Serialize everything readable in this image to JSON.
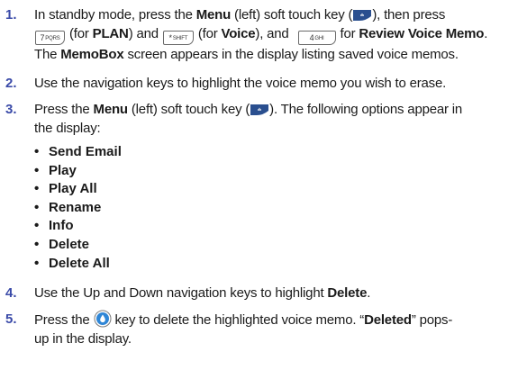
{
  "steps": [
    {
      "num": "1.",
      "line1": {
        "a": "In standby mode, press the ",
        "b": "Menu",
        "c": " (left) soft touch key (",
        "d": "), then press"
      },
      "line2": {
        "a": " (for ",
        "b": "PLAN",
        "c": ") and ",
        "d": " (for ",
        "e": "Voice",
        "f": "), and ",
        "g": " for ",
        "h": "Review Voice Memo",
        "i": "."
      },
      "line3": {
        "a": "The ",
        "b": "MemoBox",
        "c": " screen appears in the display listing saved voice memos."
      },
      "keys": {
        "seven": "7",
        "seven_sub": "PQRS",
        "star": "*",
        "star_sub": "SHIFT",
        "four": "4",
        "four_sub": "GHI"
      }
    },
    {
      "num": "2.",
      "text": "Use the navigation keys to highlight the voice memo you wish to erase."
    },
    {
      "num": "3.",
      "line1": {
        "a": "Press the ",
        "b": "Menu",
        "c": " (left) soft touch key (",
        "d": "). The following options appear in"
      },
      "line2": "the display:",
      "options": [
        "Send Email",
        "Play",
        "Play All",
        "Rename",
        "Info",
        "Delete",
        "Delete All"
      ]
    },
    {
      "num": "4.",
      "a": "Use the Up and Down navigation keys to highlight ",
      "b": "Delete",
      "c": "."
    },
    {
      "num": "5.",
      "line1": {
        "a": "Press the ",
        "b": " key to delete the highlighted voice memo. “",
        "c": "Deleted",
        "d": "” pops-"
      },
      "line2": "up in the display."
    }
  ],
  "icons": {
    "menu_softkey": "left-softkey-icon",
    "ok_key": "ok-key-icon",
    "bullet": "•"
  },
  "colors": {
    "step_number": "#3a4aa8",
    "softkey_fill": "#2a4f8f",
    "okkey_fill": "#2f86d6"
  }
}
